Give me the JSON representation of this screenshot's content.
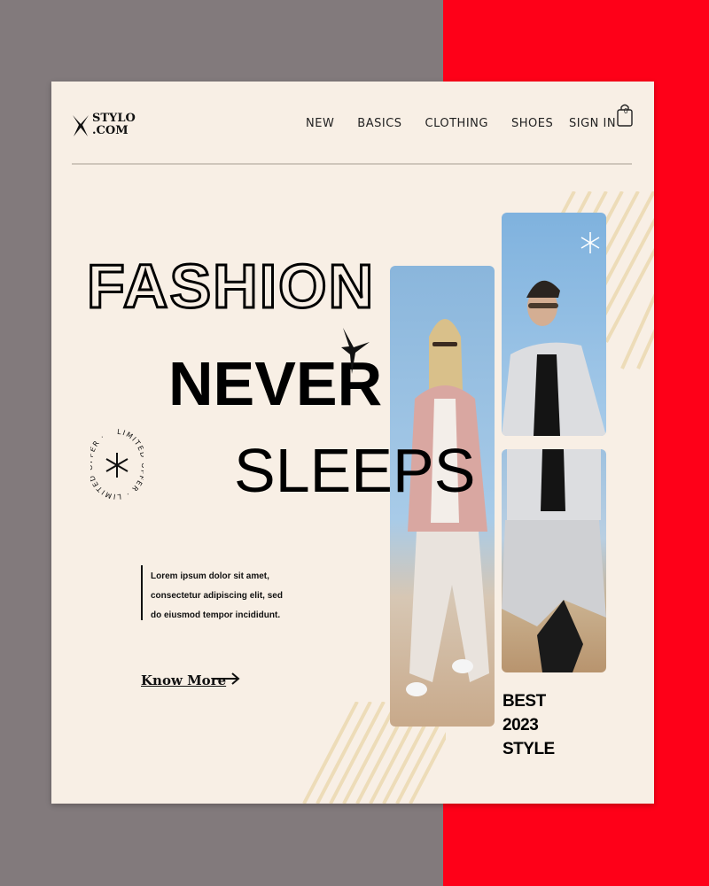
{
  "brand": {
    "line1": "STYLO",
    "line2": ".COM"
  },
  "nav": {
    "items": [
      {
        "label": "NEW"
      },
      {
        "label": "BASICS"
      },
      {
        "label": "CLOTHING"
      },
      {
        "label": "SHOES"
      }
    ],
    "signin": "SIGN IN",
    "cart_count": "0"
  },
  "hero": {
    "line1": "FASHION",
    "line2": "NEVER",
    "line3": "SLEEPS"
  },
  "stamp_text": "LIMITED OFFER · LIMITED OFFER ·",
  "description": {
    "line1": "Lorem ipsum dolor sit amet,",
    "line2": "consectetur adipiscing elit, sed",
    "line3": "do eiusmod tempor incididunt."
  },
  "cta": {
    "label": "Know More"
  },
  "badge": {
    "line1": "BEST",
    "line2": "2023",
    "line3": "STYLE"
  },
  "colors": {
    "left_bg": "#827a7c",
    "right_bg": "#fe0018",
    "card_bg": "#f8efe5",
    "stripes": "#eddcb8",
    "sky": "#8fb8dc"
  }
}
